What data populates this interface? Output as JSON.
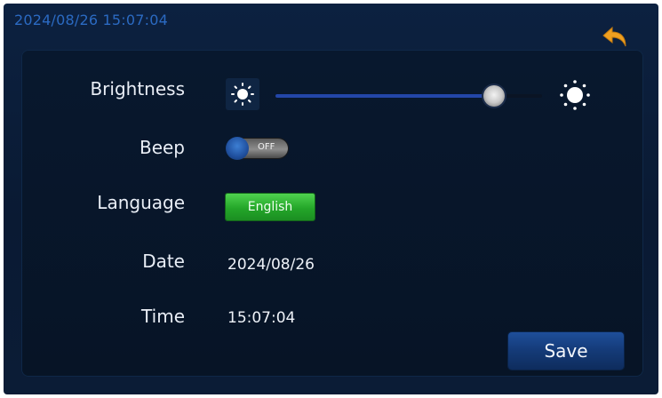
{
  "status_bar": {
    "datetime": "2024/08/26 15:07:04",
    "back_icon": "return-arrow-icon",
    "back_color": "#f0a020"
  },
  "settings": {
    "brightness": {
      "label": "Brightness",
      "value_fraction": 0.82,
      "icon_min": "sun-small-icon",
      "icon_max": "sun-large-icon"
    },
    "beep": {
      "label": "Beep",
      "state": "OFF"
    },
    "language": {
      "label": "Language",
      "value": "English",
      "button_color": "#26a82b"
    },
    "date": {
      "label": "Date",
      "value": "2024/08/26"
    },
    "time": {
      "label": "Time",
      "value": "15:07:04"
    }
  },
  "actions": {
    "save_label": "Save",
    "save_color": "#163d7a"
  },
  "colors": {
    "background": "#0a1a33",
    "panel": "#07162a",
    "datetime_text": "#2b6ac2",
    "slider_fill": "#2346a8",
    "label_text": "#e9eef6"
  }
}
